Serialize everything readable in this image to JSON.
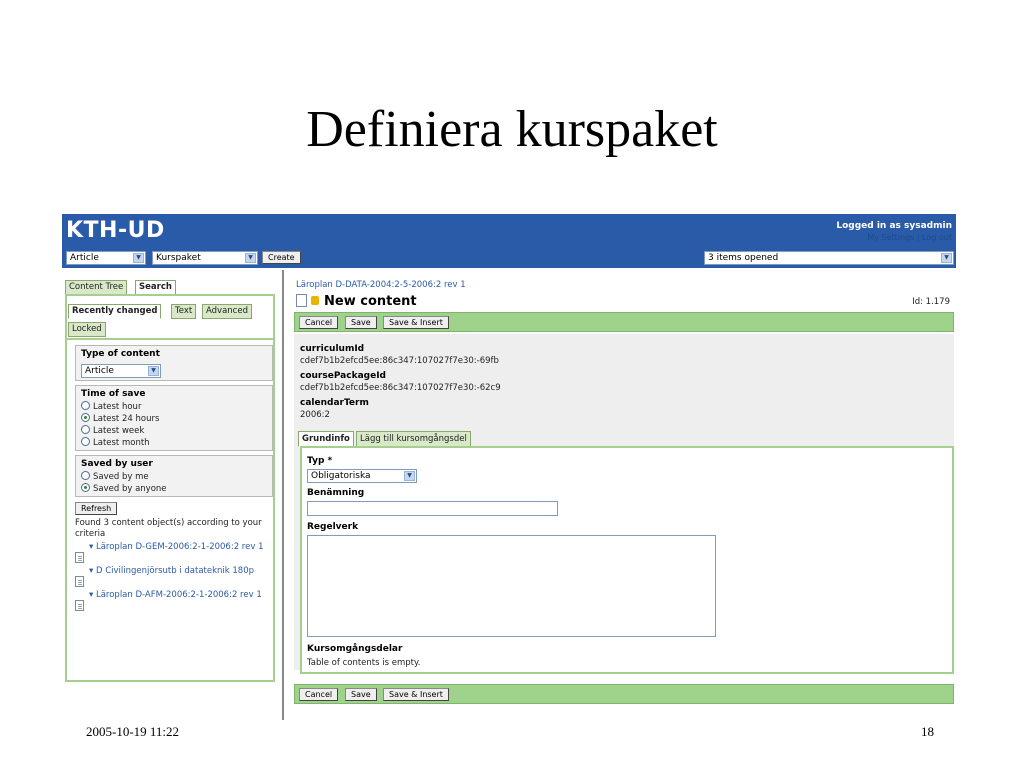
{
  "slide": {
    "title": "Definiera kurspaket",
    "date": "2005-10-19 11:22",
    "page": "18"
  },
  "app": {
    "logo": "KTH-UD",
    "login": "Logged in as sysadmin",
    "user_links": "My Settings | Log out",
    "type_select": "Article",
    "template_select": "Kurspaket",
    "create_label": "Create",
    "opened_select": "3 items opened"
  },
  "left": {
    "tabs": [
      "Content Tree",
      "Search"
    ],
    "subtabs": [
      "Recently changed",
      "Text",
      "Advanced",
      "Locked"
    ],
    "type_title": "Type of content",
    "type_value": "Article",
    "time_title": "Time of save",
    "time_options": [
      "Latest hour",
      "Latest 24 hours",
      "Latest week",
      "Latest month"
    ],
    "time_selected": 1,
    "user_title": "Saved by user",
    "user_options": [
      "Saved by me",
      "Saved by anyone"
    ],
    "user_selected": 1,
    "refresh_label": "Refresh",
    "result_text": "Found 3 content object(s) according to your criteria",
    "results": [
      "▾ Läroplan D-GEM-2006:2-1-2006:2 rev 1",
      "▾ D Civilingenjörsutb i datateknik 180p",
      "▾ Läroplan D-AFM-2006:2-1-2006:2 rev 1"
    ]
  },
  "main": {
    "breadcrumb": "Läroplan D-DATA-2004:2-5-2006:2 rev 1",
    "heading": "New content",
    "id_text": "Id: 1.179",
    "buttons": [
      "Cancel",
      "Save",
      "Save & Insert"
    ],
    "fields": [
      {
        "label": "curriculumId",
        "value": "cdef7b1b2efcd5ee:86c347:107027f7e30:-69fb"
      },
      {
        "label": "coursePackageId",
        "value": "cdef7b1b2efcd5ee:86c347:107027f7e30:-62c9"
      },
      {
        "label": "calendarTerm",
        "value": "2006:2"
      }
    ],
    "tabs": [
      "Grundinfo",
      "Lägg till kursomgångsdel"
    ],
    "typ_label": "Typ *",
    "typ_value": "Obligatoriska",
    "benamning_label": "Benämning",
    "regelverk_label": "Regelverk",
    "kursomgangsdelar_label": "Kursomgångsdelar",
    "kursomgangsdelar_value": "Table of contents is empty."
  }
}
